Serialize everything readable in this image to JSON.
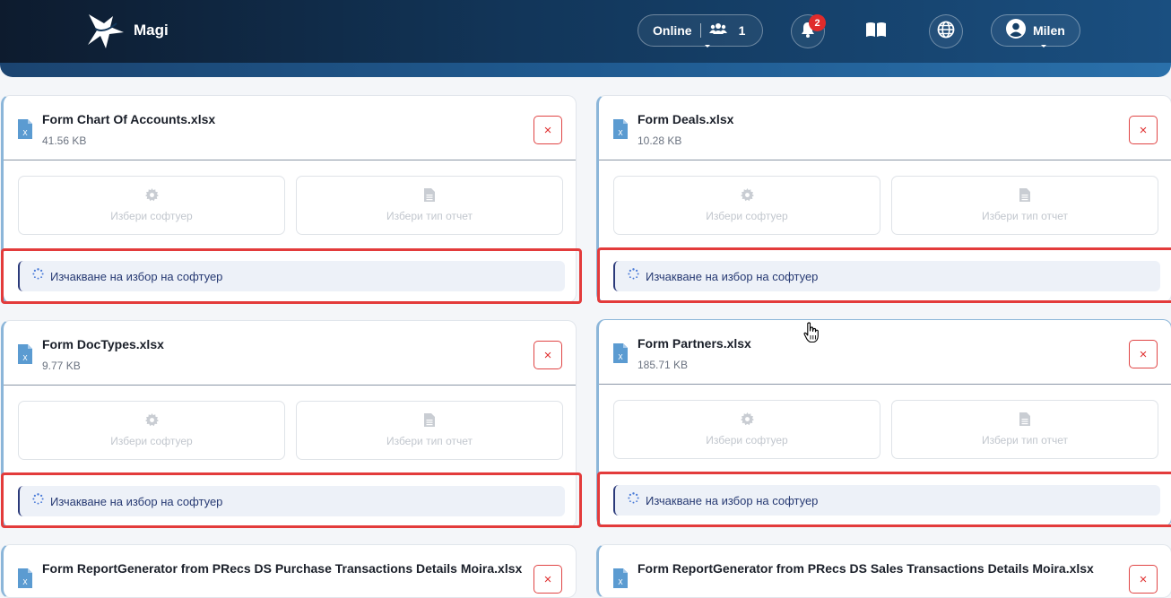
{
  "header": {
    "brand": "Magi",
    "online_label": "Online",
    "online_count": "1",
    "notification_count": "2",
    "user_name": "Milen"
  },
  "cards": [
    {
      "file_name": "Form Chart Of Accounts.xlsx",
      "file_size": "41.56 KB",
      "software_label": "Избери софтуер",
      "report_type_label": "Избери тип отчет",
      "status_text": "Изчакване на избор на софтуер"
    },
    {
      "file_name": "Form Deals.xlsx",
      "file_size": "10.28 KB",
      "software_label": "Избери софтуер",
      "report_type_label": "Избери тип отчет",
      "status_text": "Изчакване на избор на софтуер"
    },
    {
      "file_name": "Form DocTypes.xlsx",
      "file_size": "9.77 KB",
      "software_label": "Избери софтуер",
      "report_type_label": "Избери тип отчет",
      "status_text": "Изчакване на избор на софтуер"
    },
    {
      "file_name": "Form Partners.xlsx",
      "file_size": "185.71 KB",
      "software_label": "Избери софтуер",
      "report_type_label": "Избери тип отчет",
      "status_text": "Изчакване на избор на софтуер"
    },
    {
      "file_name": "Form ReportGenerator from PRecs DS Purchase Transactions Details Moira.xlsx"
    },
    {
      "file_name": "Form ReportGenerator from PRecs DS Sales Transactions Details Moira.xlsx"
    }
  ],
  "icons": {
    "delete": "×",
    "file": "file-excel-icon",
    "software": "gear-icon",
    "report_type": "document-icon",
    "status": "spinner-icon"
  },
  "colors": {
    "header_dark": "#0d1b2e",
    "header_light": "#1a4f80",
    "delete_red": "#e03131",
    "highlight_red": "#e33b3b",
    "status_text": "#273a73",
    "file_icon": "#5b9bd1"
  }
}
